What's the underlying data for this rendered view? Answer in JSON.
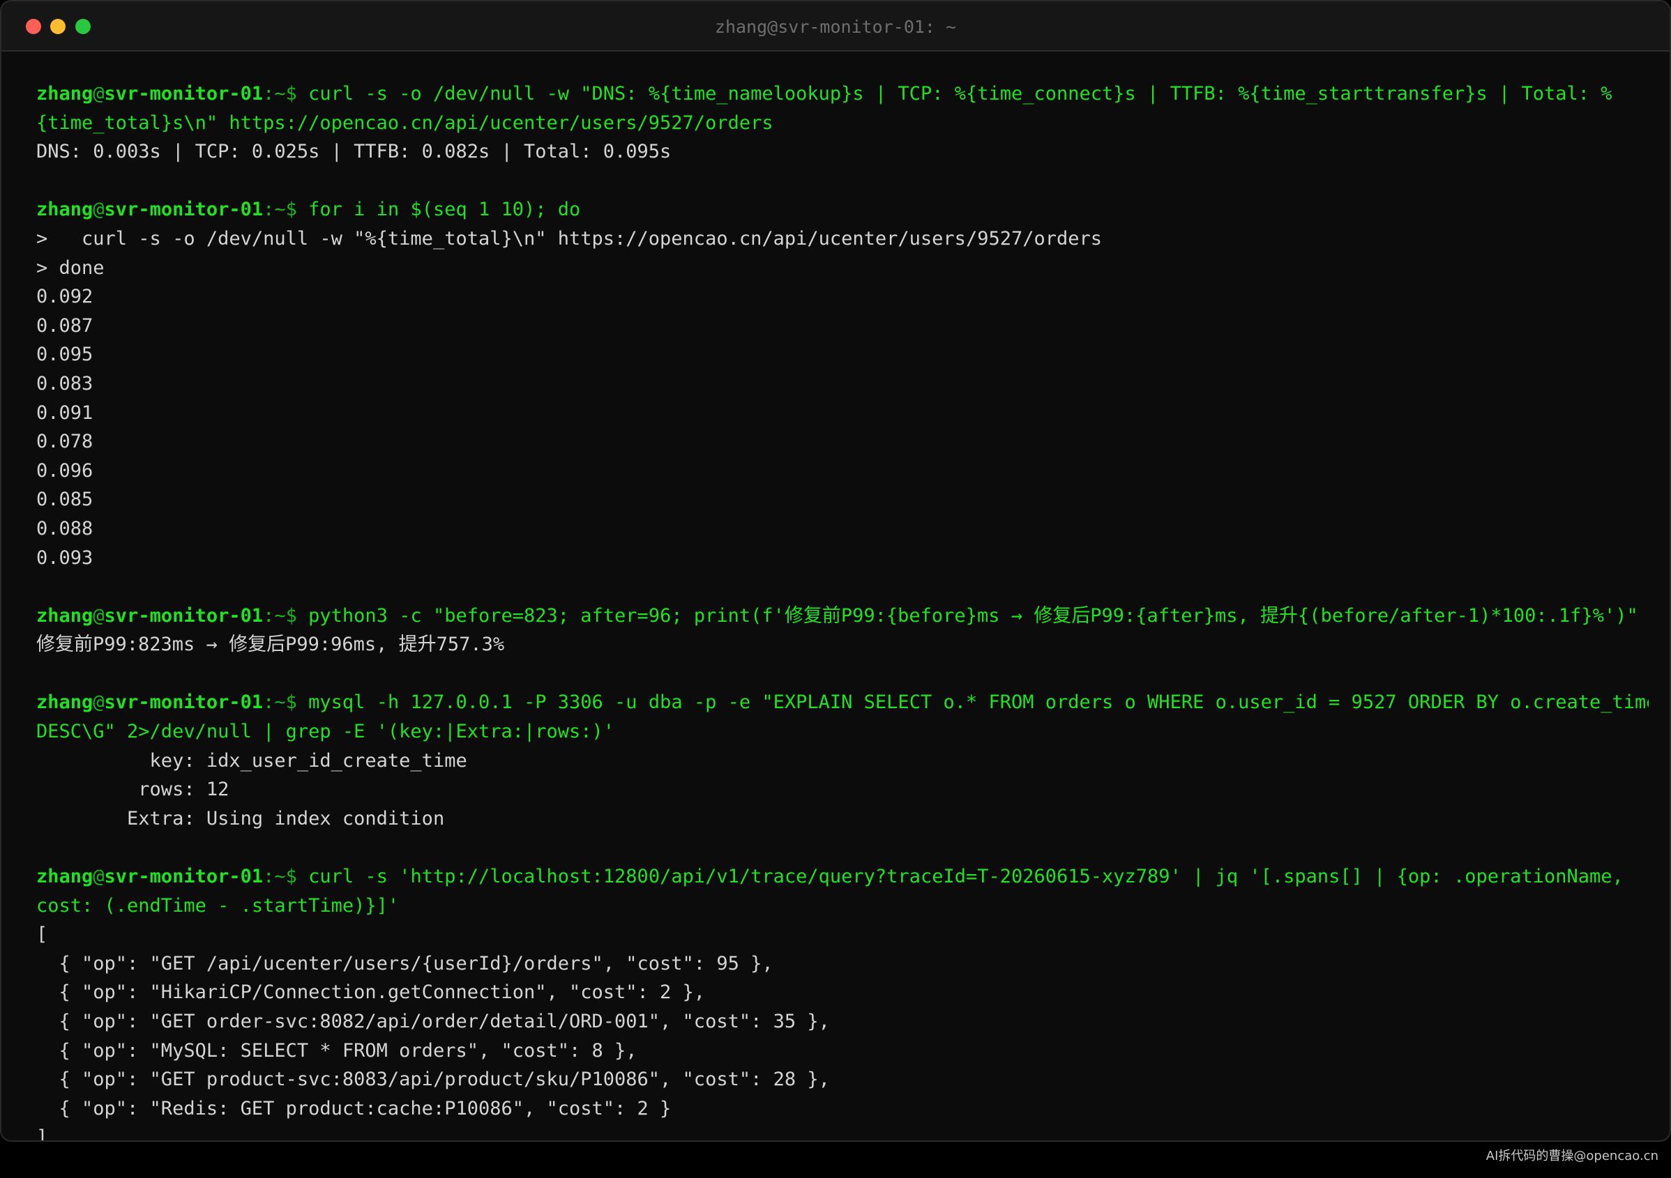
{
  "window": {
    "title": "zhang@svr-monitor-01: ~"
  },
  "colors": {
    "background": "#0c0c0c",
    "titlebar": "#161616",
    "output_text": "#d4d4d4",
    "prompt_green": "#22e022",
    "close": "#fe5f57",
    "minimize": "#febc2e",
    "maximize": "#28c840"
  },
  "prompt": {
    "user": "zhang",
    "at": "@",
    "host": "svr-monitor-01",
    "path": ":~$ "
  },
  "lines": [
    {
      "type": "prompt",
      "text": "curl -s -o /dev/null -w \"DNS: %{time_namelookup}s | TCP: %{time_connect}s | TTFB: %{time_starttransfer}s | Total: %"
    },
    {
      "type": "cont",
      "text": "{time_total}s\\n\" https://opencao.cn/api/ucenter/users/9527/orders"
    },
    {
      "type": "out",
      "text": "DNS: 0.003s | TCP: 0.025s | TTFB: 0.082s | Total: 0.095s"
    },
    {
      "type": "blank",
      "text": ""
    },
    {
      "type": "prompt",
      "text": "for i in $(seq 1 10); do"
    },
    {
      "type": "out",
      "text": ">   curl -s -o /dev/null -w \"%{time_total}\\n\" https://opencao.cn/api/ucenter/users/9527/orders"
    },
    {
      "type": "out",
      "text": "> done"
    },
    {
      "type": "out",
      "text": "0.092"
    },
    {
      "type": "out",
      "text": "0.087"
    },
    {
      "type": "out",
      "text": "0.095"
    },
    {
      "type": "out",
      "text": "0.083"
    },
    {
      "type": "out",
      "text": "0.091"
    },
    {
      "type": "out",
      "text": "0.078"
    },
    {
      "type": "out",
      "text": "0.096"
    },
    {
      "type": "out",
      "text": "0.085"
    },
    {
      "type": "out",
      "text": "0.088"
    },
    {
      "type": "out",
      "text": "0.093"
    },
    {
      "type": "blank",
      "text": ""
    },
    {
      "type": "prompt",
      "text": "python3 -c \"before=823; after=96; print(f'修复前P99:{before}ms → 修复后P99:{after}ms, 提升{(before/after-1)*100:.1f}%')\""
    },
    {
      "type": "out",
      "text": "修复前P99:823ms → 修复后P99:96ms, 提升757.3%"
    },
    {
      "type": "blank",
      "text": ""
    },
    {
      "type": "prompt",
      "text": "mysql -h 127.0.0.1 -P 3306 -u dba -p -e \"EXPLAIN SELECT o.* FROM orders o WHERE o.user_id = 9527 ORDER BY o.create_time"
    },
    {
      "type": "cont",
      "text": "DESC\\G\" 2>/dev/null | grep -E '(key:|Extra:|rows:)'"
    },
    {
      "type": "out",
      "text": "          key: idx_user_id_create_time"
    },
    {
      "type": "out",
      "text": "         rows: 12"
    },
    {
      "type": "out",
      "text": "        Extra: Using index condition"
    },
    {
      "type": "blank",
      "text": ""
    },
    {
      "type": "prompt",
      "text": "curl -s 'http://localhost:12800/api/v1/trace/query?traceId=T-20260615-xyz789' | jq '[.spans[] | {op: .operationName,"
    },
    {
      "type": "cont",
      "text": "cost: (.endTime - .startTime)}]'"
    },
    {
      "type": "out",
      "text": "["
    },
    {
      "type": "out",
      "text": "  { \"op\": \"GET /api/ucenter/users/{userId}/orders\", \"cost\": 95 },"
    },
    {
      "type": "out",
      "text": "  { \"op\": \"HikariCP/Connection.getConnection\", \"cost\": 2 },"
    },
    {
      "type": "out",
      "text": "  { \"op\": \"GET order-svc:8082/api/order/detail/ORD-001\", \"cost\": 35 },"
    },
    {
      "type": "out",
      "text": "  { \"op\": \"MySQL: SELECT * FROM orders\", \"cost\": 8 },"
    },
    {
      "type": "out",
      "text": "  { \"op\": \"GET product-svc:8083/api/product/sku/P10086\", \"cost\": 28 },"
    },
    {
      "type": "out",
      "text": "  { \"op\": \"Redis: GET product:cache:P10086\", \"cost\": 2 }"
    },
    {
      "type": "out",
      "text": "]"
    }
  ],
  "watermark": "AI拆代码的曹操@opencao.cn"
}
